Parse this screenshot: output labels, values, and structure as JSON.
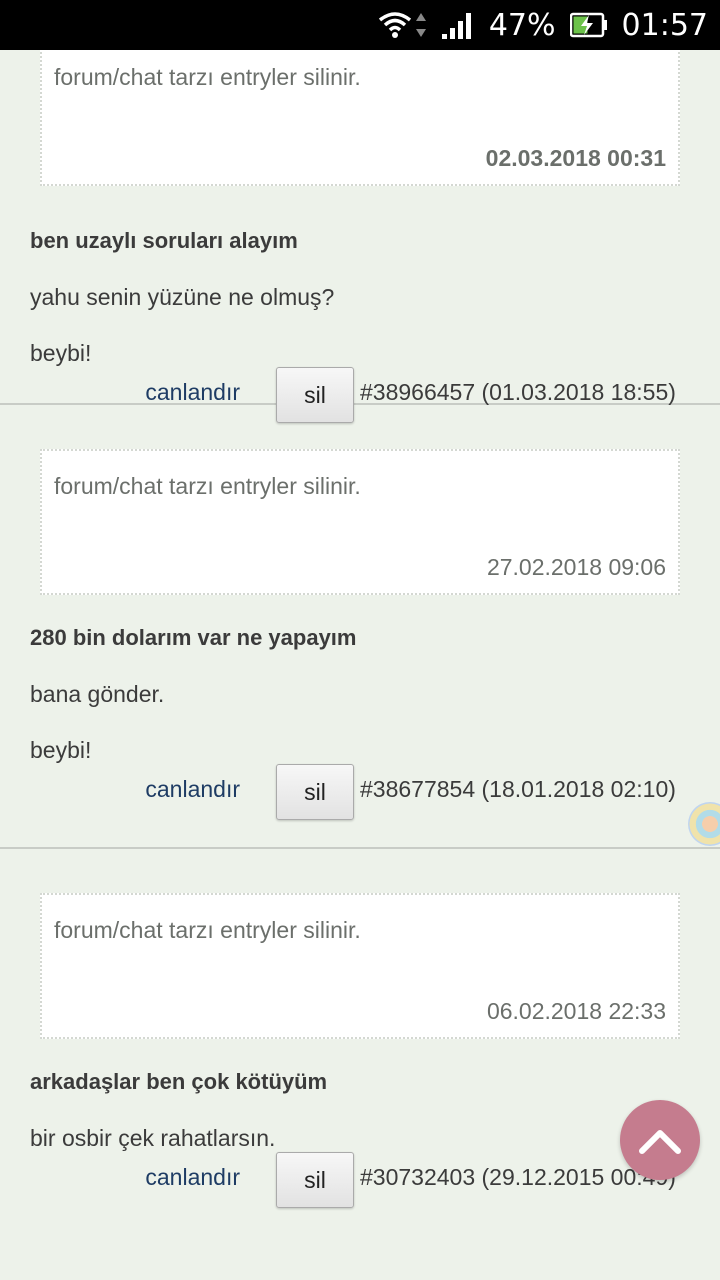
{
  "status_bar": {
    "battery_percent": "47%",
    "time": "01:57",
    "icons": [
      "wifi-icon",
      "data-arrows-icon",
      "signal-icon",
      "battery-charging-icon"
    ]
  },
  "entries": [
    {
      "warning_text": "forum/chat tarzı entryler silinir.",
      "warning_date": "02.03.2018 00:31",
      "title": "ben uzaylı soruları alayım",
      "paragraphs": [
        "yahu senin yüzüne ne olmuş?",
        "beybi!"
      ],
      "revive_label": "canlandır",
      "delete_label": "sil",
      "entry_id": "#38966457 (01.03.2018 18:55)"
    },
    {
      "warning_text": "forum/chat tarzı entryler silinir.",
      "warning_date": "27.02.2018 09:06",
      "title": "280 bin dolarım var ne yapayım",
      "paragraphs": [
        "bana gönder.",
        "beybi!"
      ],
      "revive_label": "canlandır",
      "delete_label": "sil",
      "entry_id": "#38677854 (18.01.2018 02:10)"
    },
    {
      "warning_text": "forum/chat tarzı entryler silinir.",
      "warning_date": "06.02.2018 22:33",
      "title": "arkadaşlar ben çok kötüyüm",
      "paragraphs": [
        "bir osbir çek rahatlarsın."
      ],
      "revive_label": "canlandır",
      "delete_label": "sil",
      "entry_id": "#30732403 (29.12.2015 00:49)"
    }
  ],
  "scroll_top_button": {
    "icon": "chevron-up-icon",
    "color": "#c57c8e"
  }
}
